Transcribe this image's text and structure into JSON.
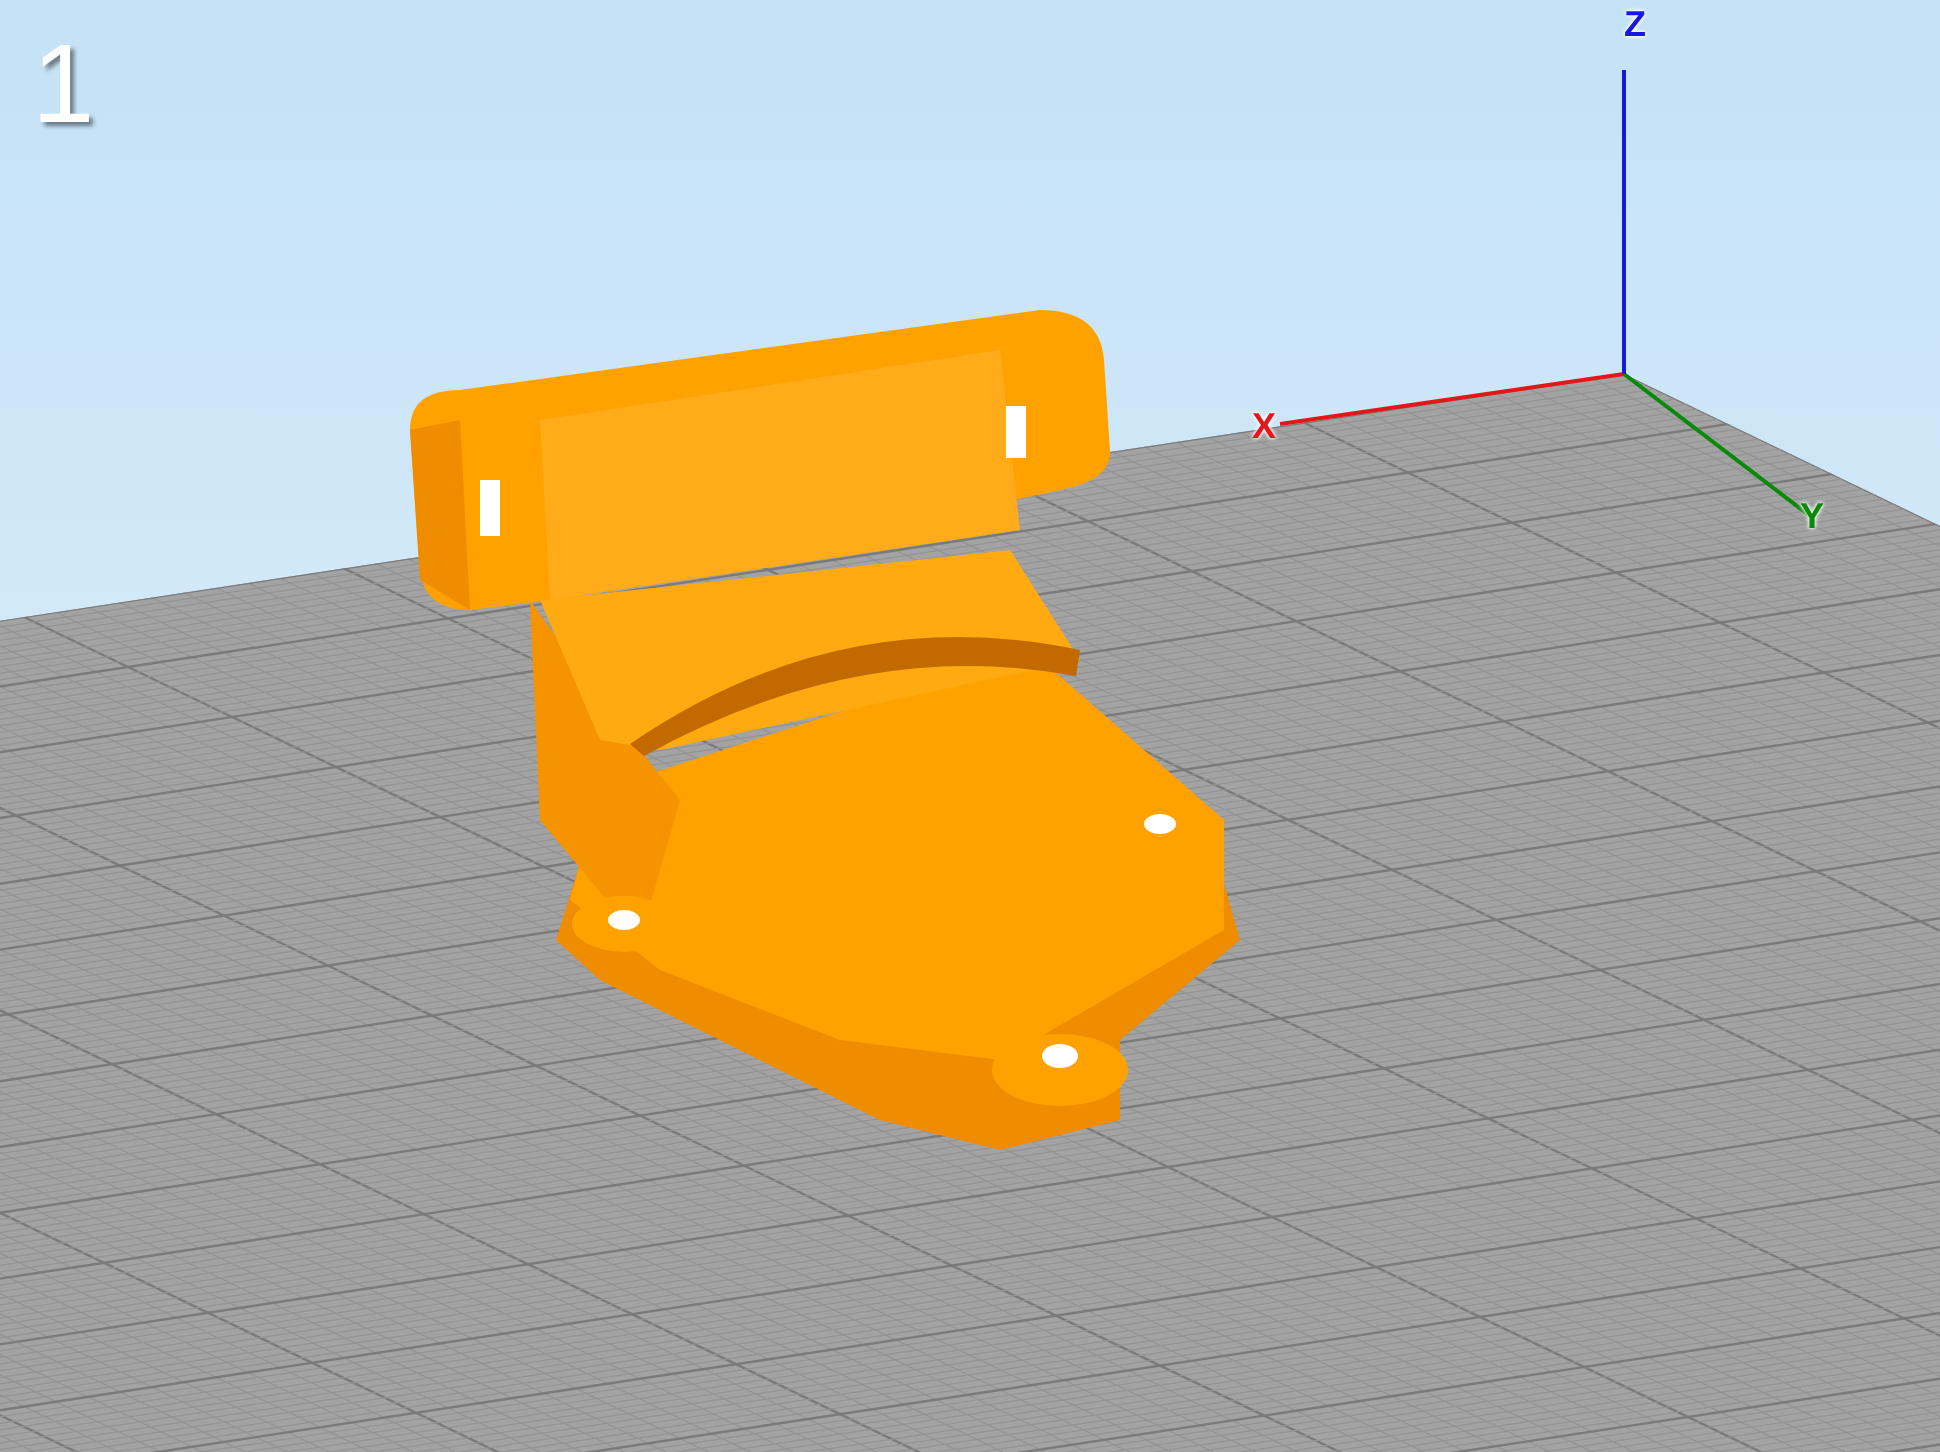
{
  "viewport": {
    "view_number": "1",
    "axes": [
      {
        "label": "X",
        "color": "#e01818"
      },
      {
        "label": "Y",
        "color": "#0a8a0a"
      },
      {
        "label": "Z",
        "color": "#1818e0"
      }
    ]
  }
}
